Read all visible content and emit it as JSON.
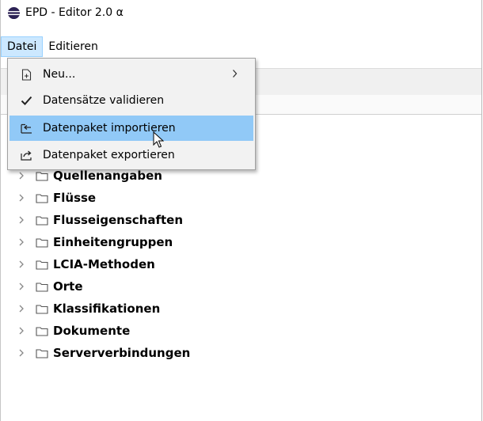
{
  "window": {
    "title": "EPD - Editor 2.0 α"
  },
  "menubar": {
    "items": [
      {
        "label": "Datei"
      },
      {
        "label": "Editieren"
      }
    ]
  },
  "file_menu": {
    "items": [
      {
        "label": "Neu...",
        "icon": "new-file-icon",
        "has_submenu": true
      },
      {
        "label": "Datensätze validieren",
        "icon": "checkmark-icon"
      },
      {
        "label": "Datenpaket importieren",
        "icon": "import-icon",
        "highlighted": true
      },
      {
        "label": "Datenpaket exportieren",
        "icon": "export-icon"
      }
    ]
  },
  "tree": {
    "items": [
      {
        "label": "Quellenangaben"
      },
      {
        "label": "Flüsse"
      },
      {
        "label": "Flusseigenschaften"
      },
      {
        "label": "Einheitengruppen"
      },
      {
        "label": "LCIA-Methoden"
      },
      {
        "label": "Orte"
      },
      {
        "label": "Klassifikationen"
      },
      {
        "label": "Dokumente"
      },
      {
        "label": "Serververbindungen"
      }
    ]
  },
  "colors": {
    "menu_active_bg": "#cce8ff",
    "menu_highlight_bg": "#91c9f7",
    "popup_bg": "#f2f2f2"
  }
}
